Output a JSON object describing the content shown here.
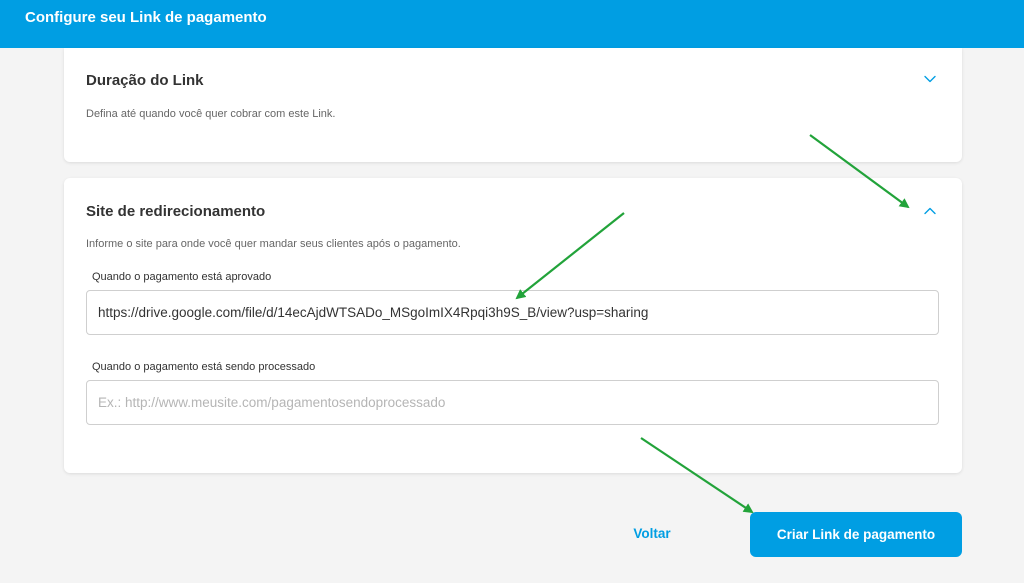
{
  "header": {
    "title": "Configure seu Link de pagamento"
  },
  "sections": {
    "duration": {
      "title": "Duração do Link",
      "description": "Defina até quando você quer cobrar com este Link.",
      "expanded": false
    },
    "redirect": {
      "title": "Site de redirecionamento",
      "description": "Informe o site para onde você quer mandar seus clientes após o pagamento.",
      "expanded": true,
      "approved_label": "Quando o pagamento está aprovado",
      "approved_value": "https://drive.google.com/file/d/14ecAjdWTSADo_MSgoImIX4Rpqi3h9S_B/view?usp=sharing",
      "processing_label": "Quando o pagamento está sendo processado",
      "processing_value": "",
      "processing_placeholder": "Ex.: http://www.meusite.com/pagamentosendoprocessado"
    }
  },
  "footer": {
    "back_label": "Voltar",
    "create_label": "Criar Link de pagamento"
  },
  "colors": {
    "brand_blue": "#009ee3",
    "annotation_arrow": "#22a33a",
    "background": "#f4f4f4"
  }
}
